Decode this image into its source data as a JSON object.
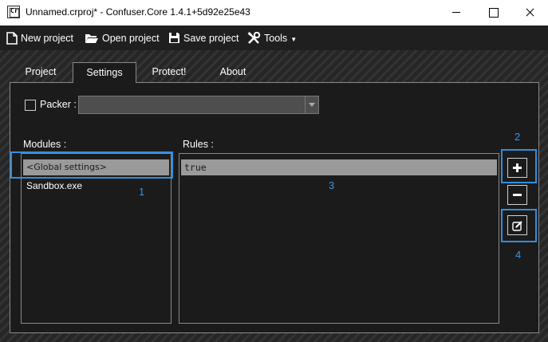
{
  "window": {
    "app_icon_text": "Cr",
    "title": "Unnamed.crproj* - Confuser.Core 1.4.1+5d92e25e43"
  },
  "toolbar": {
    "new_project": "New project",
    "open_project": "Open project",
    "save_project": "Save project",
    "tools": "Tools"
  },
  "tabs": [
    {
      "label": "Project",
      "selected": false
    },
    {
      "label": "Settings",
      "selected": true
    },
    {
      "label": "Protect!",
      "selected": false
    },
    {
      "label": "About",
      "selected": false
    }
  ],
  "settings": {
    "packer_label": "Packer :",
    "packer_checked": false,
    "packer_value": "",
    "modules_label": "Modules :",
    "modules": [
      "<Global settings>",
      "Sandbox.exe"
    ],
    "selected_module": "<Global settings>",
    "rules_label": "Rules :",
    "rules": [
      "true"
    ]
  },
  "annotations": {
    "n1": "1",
    "n2": "2",
    "n3": "3",
    "n4": "4",
    "color": "#2f8fe0"
  },
  "colors": {
    "panel_bg": "#1b1b1b",
    "selection_bg": "#9a9a9a",
    "border": "#8a8a8a"
  },
  "icons": [
    "new-file-icon",
    "open-folder-icon",
    "save-disk-icon",
    "tools-icon",
    "add-icon",
    "remove-icon",
    "edit-icon"
  ]
}
